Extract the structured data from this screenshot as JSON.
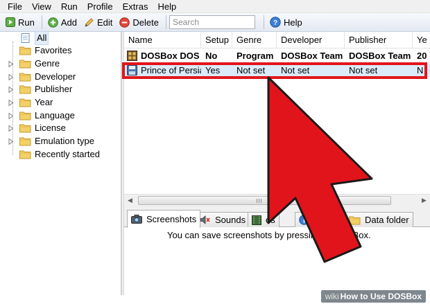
{
  "menu": [
    "File",
    "View",
    "Run",
    "Profile",
    "Extras",
    "Help"
  ],
  "toolbar": {
    "run_label": "Run",
    "add_label": "Add",
    "edit_label": "Edit",
    "delete_label": "Delete",
    "search_placeholder": "Search",
    "help_label": "Help"
  },
  "tree": {
    "items": [
      {
        "label": "All",
        "selected": true
      },
      {
        "label": "Favorites"
      },
      {
        "label": "Genre"
      },
      {
        "label": "Developer"
      },
      {
        "label": "Publisher"
      },
      {
        "label": "Year"
      },
      {
        "label": "Language"
      },
      {
        "label": "License"
      },
      {
        "label": "Emulation type"
      },
      {
        "label": "Recently started"
      }
    ]
  },
  "grid": {
    "columns": [
      "Name",
      "Setup",
      "Genre",
      "Developer",
      "Publisher",
      "Ye"
    ],
    "rows": [
      [
        "DOSBox DOS",
        "No",
        "Program",
        "DOSBox Team",
        "DOSBox Team",
        "20"
      ],
      [
        "Prince of Persia",
        "Yes",
        "Not set",
        "Not set",
        "Not set",
        "N"
      ]
    ]
  },
  "bottom": {
    "tabs": [
      "Screenshots",
      "Sounds",
      "os",
      "",
      "Data folder"
    ],
    "hint": "You can save screenshots by pressing Ctrl                  OSBox."
  },
  "watermark": {
    "wiki": "wiki",
    "text": "How to Use DOSBox"
  },
  "colors": {
    "highlight": "#e2141b",
    "arrow": "#e2141b",
    "selection": "#dcebfb"
  }
}
